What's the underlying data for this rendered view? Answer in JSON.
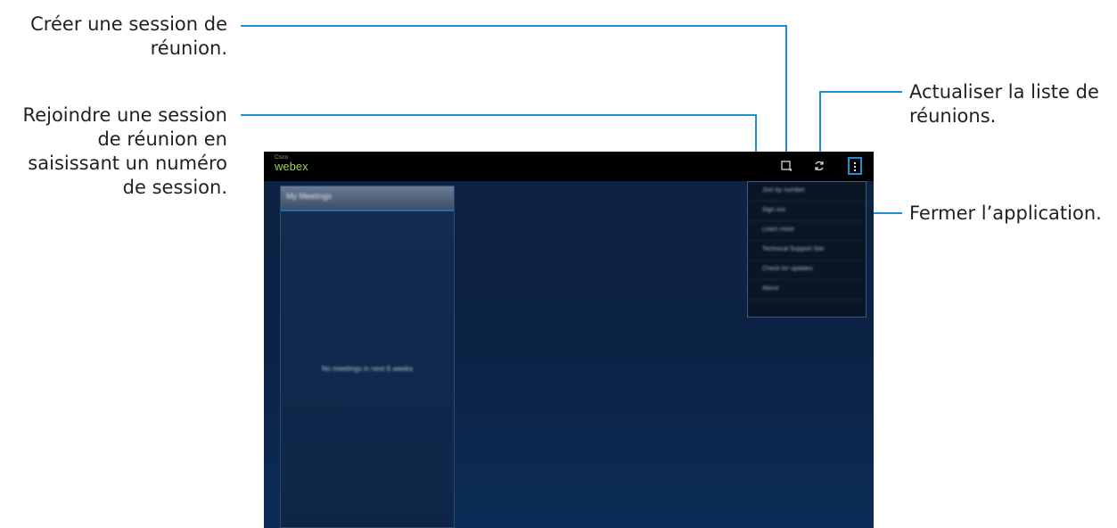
{
  "callouts": {
    "create": [
      "Créer une session de",
      "réunion."
    ],
    "join": [
      "Rejoindre une session",
      "de réunion en",
      "saisissant un numéro",
      "de session."
    ],
    "refresh": [
      "Actualiser la liste de",
      "réunions."
    ],
    "close": [
      "Fermer l’application."
    ]
  },
  "app": {
    "brand_small": "Cisco",
    "brand": "webex",
    "panel_title": "My Meetings",
    "panel_empty": "No meetings in next 6 weeks",
    "menu_items": [
      "Join by number",
      "Sign out",
      "Learn more",
      "Technical Support Site",
      "Check for updates",
      "About"
    ]
  },
  "colors": {
    "leader": "#1e8fd6",
    "accent_green": "#9dcf4c",
    "highlight": "#1e8fd6"
  },
  "icons": {
    "new_meeting": "new-meeting-icon",
    "refresh": "refresh-icon",
    "overflow": "overflow-menu-icon"
  }
}
